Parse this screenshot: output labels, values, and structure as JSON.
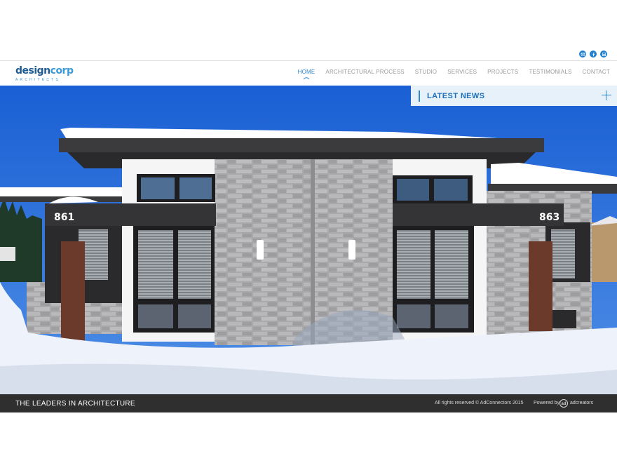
{
  "social": {
    "icons": [
      "email-icon",
      "facebook-icon",
      "linkedin-icon"
    ]
  },
  "logo": {
    "word1": "design",
    "word2": "corp",
    "subtitle": "ARCHITECTS"
  },
  "nav": {
    "items": [
      {
        "label": "HOME",
        "active": true
      },
      {
        "label": "ARCHITECTURAL PROCESS",
        "active": false
      },
      {
        "label": "STUDIO",
        "active": false
      },
      {
        "label": "SERVICES",
        "active": false
      },
      {
        "label": "PROJECTS",
        "active": false
      },
      {
        "label": "TESTIMONIALS",
        "active": false
      },
      {
        "label": "CONTACT",
        "active": false
      }
    ]
  },
  "news": {
    "label": "LATEST NEWS"
  },
  "hero": {
    "left_number": "861",
    "right_number": "863"
  },
  "footer": {
    "tagline": "THE LEADERS IN ARCHITECTURE",
    "rights": "All rights reserved © AdConnectors 2015",
    "powered_by": "Powered by",
    "brand": "adcreators"
  },
  "colors": {
    "accent": "#2e86d1",
    "footer_bg": "#2f2f2f",
    "news_bg": "#e6f1fa"
  }
}
